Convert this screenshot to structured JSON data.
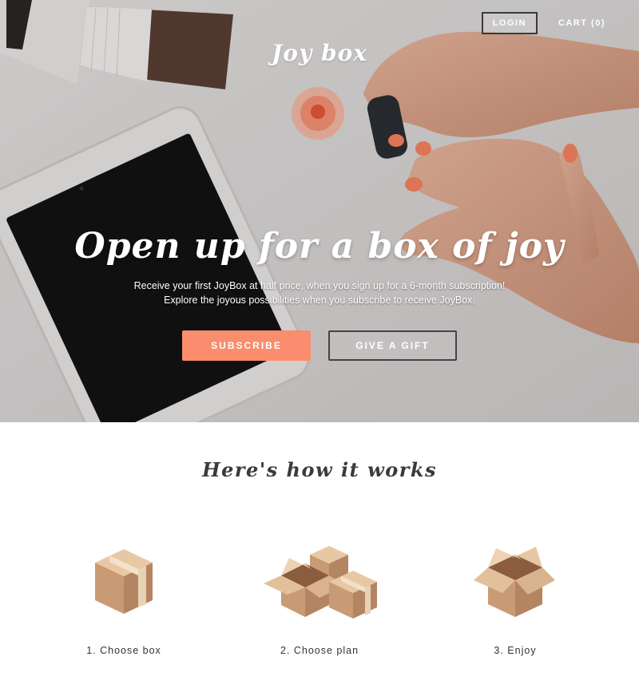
{
  "brand": {
    "name": "Joy box"
  },
  "nav": {
    "login_label": "LOGIN",
    "cart_label": "CART (0)"
  },
  "hero": {
    "headline": "Open up for a box of joy",
    "subtext_line1": "Receive your first JoyBox at half price, when you sign up for a 6-month subscription!",
    "subtext_line2": "Explore the joyous possibilities when you subscribe to receive JoyBox.",
    "subscribe_label": "SUBSCRIBE",
    "gift_label": "GIVE A GIFT"
  },
  "how": {
    "title": "Here's how it works",
    "steps": [
      {
        "label": "1. Choose box",
        "icon": "closed-box-icon"
      },
      {
        "label": "2. Choose plan",
        "icon": "boxes-icon"
      },
      {
        "label": "3. Enjoy",
        "icon": "open-box-icon"
      }
    ]
  },
  "colors": {
    "accent": "#f98d6d",
    "text_dark": "#3a3a3a",
    "hero_bg": "#d9d6d6"
  }
}
